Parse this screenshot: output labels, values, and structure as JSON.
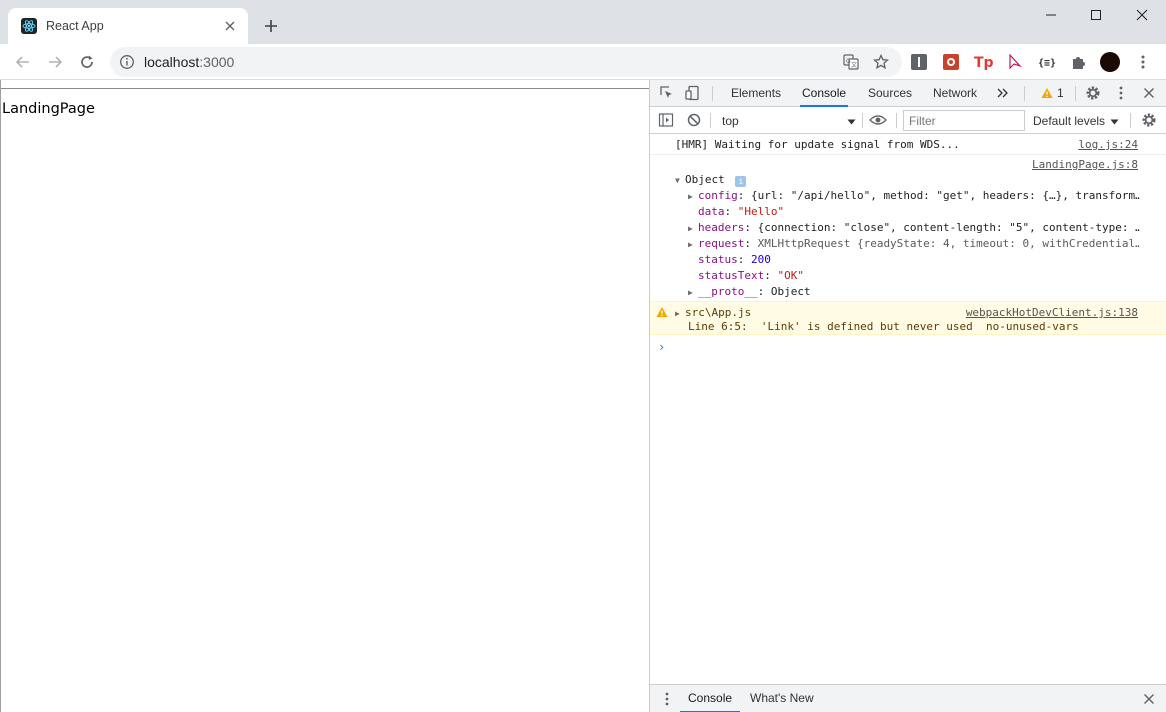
{
  "browser": {
    "tab_title": "React App",
    "url_host": "localhost",
    "url_port": ":3000"
  },
  "page": {
    "heading": "LandingPage"
  },
  "devtools": {
    "tabs": [
      "Elements",
      "Console",
      "Sources",
      "Network"
    ],
    "active_tab": "Console",
    "warning_count": "1",
    "context": "top",
    "filter_placeholder": "Filter",
    "levels_label": "Default levels",
    "drawer_tabs": [
      "Console",
      "What's New"
    ]
  },
  "console": {
    "hmr_message": "[HMR] Waiting for update signal from WDS...",
    "hmr_source": "log.js:24",
    "log_source": "LandingPage.js:8",
    "object_label": "Object",
    "props": {
      "config": "{url: \"/api/hello\", method: \"get\", headers: {…}, transform…",
      "data": "\"Hello\"",
      "headers": "{connection: \"close\", content-length: \"5\", content-type: …",
      "request": "XMLHttpRequest {readyState: 4, timeout: 0, withCredential…",
      "status": "200",
      "statusText": "\"OK\"",
      "proto": "Object"
    },
    "warning": {
      "file": "src\\App.js",
      "source": "webpackHotDevClient.js:138",
      "detail": "Line 6:5:  'Link' is defined but never used  no-unused-vars"
    }
  },
  "colors": {
    "accent": "#1a73e8",
    "warn_bg": "#fffbe5",
    "warn_icon": "#f2a600",
    "key": "#881280",
    "string": "#c41a16",
    "number": "#1c00cf"
  }
}
